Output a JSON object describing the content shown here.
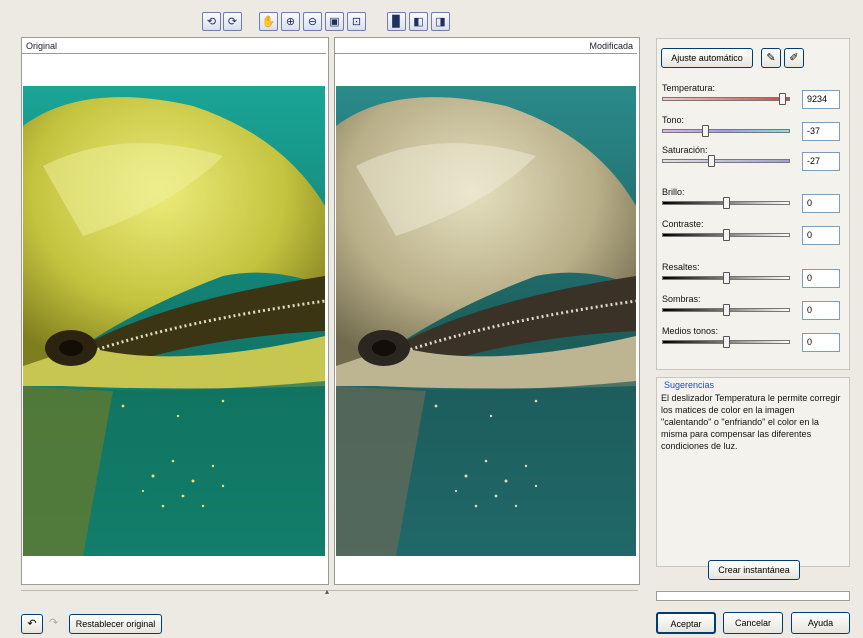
{
  "toolbar": {
    "icons": [
      "rotate-left-icon",
      "rotate-right-icon",
      "hand-pan-icon",
      "zoom-in-icon",
      "zoom-out-icon",
      "zoom-fit-icon",
      "zoom-actual-icon",
      "single-preview-icon",
      "split-preview-icon",
      "side-by-side-preview-icon"
    ]
  },
  "preview": {
    "original_label": "Original",
    "modified_label": "Modificada"
  },
  "controls": {
    "auto_adjust_label": "Ajuste automático",
    "sliders": [
      {
        "label": "Temperatura:",
        "value": "9234",
        "level": 0.97
      },
      {
        "label": "Tono:",
        "value": "-37",
        "level": 0.33
      },
      {
        "label": "Saturación:",
        "value": "-27",
        "level": 0.38
      },
      {
        "label": "Brillo:",
        "value": "0",
        "level": 0.5
      },
      {
        "label": "Contraste:",
        "value": "0",
        "level": 0.5
      },
      {
        "label": "Resaltes:",
        "value": "0",
        "level": 0.5
      },
      {
        "label": "Sombras:",
        "value": "0",
        "level": 0.5
      },
      {
        "label": "Medios tonos:",
        "value": "0",
        "level": 0.5
      }
    ]
  },
  "hints": {
    "title": "Sugerencias",
    "text": "El deslizador Temperatura le permite corregir los matices de color en la imagen \"calentando\" o \"enfriando\" el color en la misma para compensar las diferentes condiciones de luz."
  },
  "snapshot_label": "Crear instantánea",
  "bottom": {
    "reset_label": "Restablecer original",
    "ok_label": "Aceptar",
    "cancel_label": "Cancelar",
    "help_label": "Ayuda"
  },
  "colors": {
    "button_border": "#003c74",
    "hint_title": "#1a50c8"
  }
}
